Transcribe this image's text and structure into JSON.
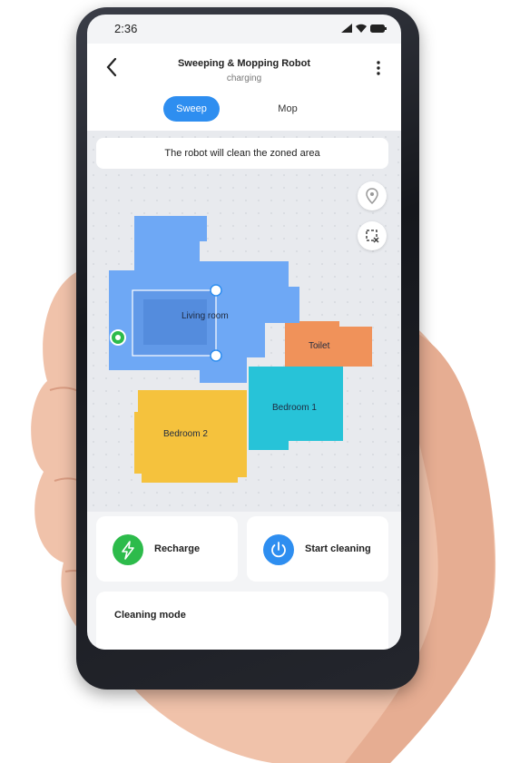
{
  "status_bar": {
    "time": "2:36"
  },
  "header": {
    "title": "Sweeping & Mopping Robot",
    "subtitle": "charging"
  },
  "tabs": [
    {
      "label": "Sweep",
      "active": true
    },
    {
      "label": "Mop",
      "active": false
    }
  ],
  "map": {
    "notice": "The robot will clean the zoned area",
    "rooms": [
      {
        "name": "Living room",
        "color": "#6ea8f5"
      },
      {
        "name": "Toilet",
        "color": "#f0925a"
      },
      {
        "name": "Bedroom 1",
        "color": "#27c3d8"
      },
      {
        "name": "Bedroom 2",
        "color": "#f5c23d"
      }
    ]
  },
  "actions": [
    {
      "label": "Recharge",
      "icon": "lightning-icon",
      "color": "#2dbb4b"
    },
    {
      "label": "Start cleaning",
      "icon": "power-icon",
      "color": "#2e8ef0"
    }
  ],
  "cleaning_mode": {
    "title": "Cleaning mode"
  },
  "colors": {
    "accent": "#2e8ef0",
    "skin": "#f1c3ad"
  }
}
